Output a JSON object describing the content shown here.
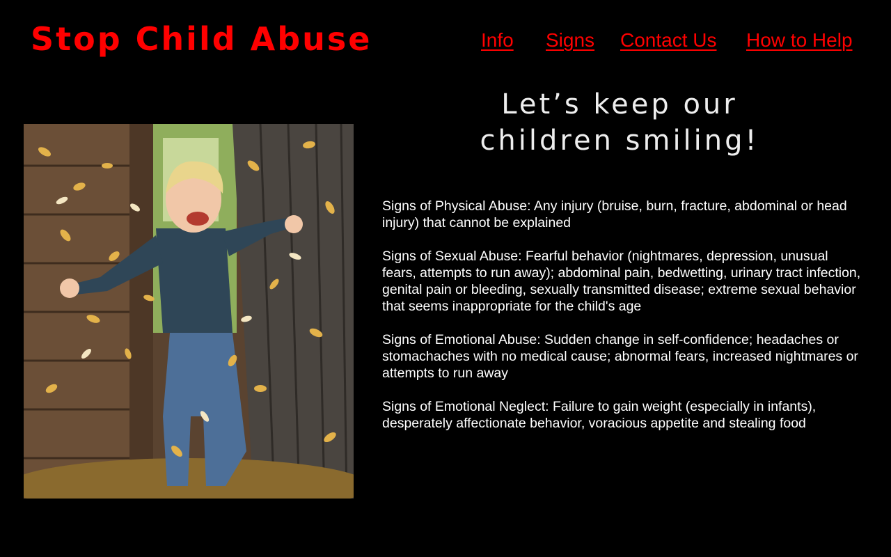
{
  "header": {
    "logo_text": "Stop Child Abuse"
  },
  "nav": {
    "items": [
      {
        "label": "Info"
      },
      {
        "label": "Signs"
      },
      {
        "label": "Contact Us"
      },
      {
        "label": "How to Help"
      }
    ]
  },
  "tagline": {
    "line1": "Let’s keep our",
    "line2": "children smiling!"
  },
  "photo": {
    "subject": "smiling child playing in autumn leaves"
  },
  "signs": [
    {
      "text": "Signs of Physical Abuse: Any injury (bruise, burn, fracture, abdominal or head injury) that cannot be explained"
    },
    {
      "text": "Signs of Sexual Abuse: Fearful behavior (nightmares, depression, unusual fears, attempts to run away); abdominal pain, bedwetting, urinary tract infection, genital pain or bleeding, sexually transmitted disease; extreme sexual behavior that seems inappropriate for the child's age"
    },
    {
      "text": "Signs of Emotional Abuse: Sudden change in self-confidence; headaches or stomachaches with no medical cause; abnormal fears, increased nightmares or attempts to run away"
    },
    {
      "text": "Signs of Emotional Neglect: Failure to gain weight (especially in infants), desperately affectionate behavior, voracious appetite and stealing food"
    }
  ],
  "colors": {
    "background": "#000000",
    "accent": "#ff0000",
    "text": "#ffffff"
  }
}
